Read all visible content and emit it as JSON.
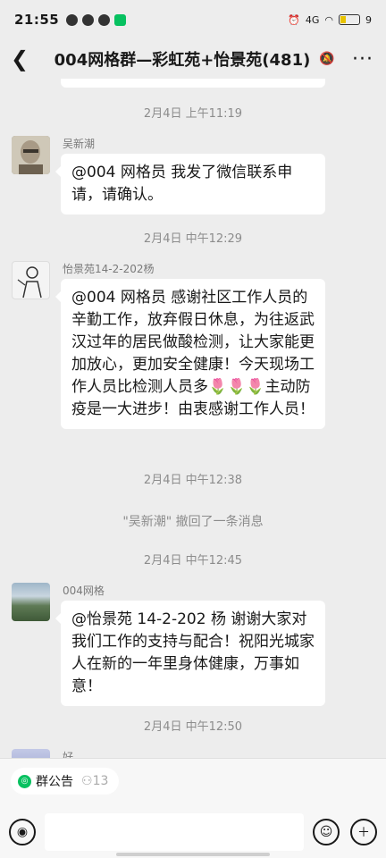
{
  "status_bar": {
    "time": "21:55",
    "network": "4G",
    "battery": "9"
  },
  "header": {
    "back_icon": "back-arrow-icon",
    "title": "004网格群—彩虹苑+怡景苑(481)",
    "more_label": "···"
  },
  "timestamps": [
    "2月4日 上午11:19",
    "2月4日 中午12:29",
    "2月4日 中午12:38",
    "2月4日 中午12:45",
    "2月4日 中午12:50"
  ],
  "messages": [
    {
      "sender": "吴新潮",
      "text": "@004 网格员  我发了微信联系申请，请确认。"
    },
    {
      "sender": "怡景苑14-2-202杨",
      "text": "@004 网格员  感谢社区工作人员的辛勤工作，放弃假日休息，为往返武汉过年的居民做酸检测，让大家能更加放心，更加安全健康！今天现场工作人员比检测人员多🌷🌷🌷主动防疫是一大进步！由衷感谢工作人员！"
    },
    {
      "sender": "004网格",
      "text": "@怡景苑 14-2-202 杨  谢谢大家对我们工作的支持与配合！祝阳光城家人在新的一年里身体健康，万事如意！"
    },
    {
      "sender": "好"
    }
  ],
  "system_notice": "\"吴新潮\" 撤回了一条消息",
  "bottom": {
    "notice_label": "群公告",
    "notice_count": "13"
  }
}
